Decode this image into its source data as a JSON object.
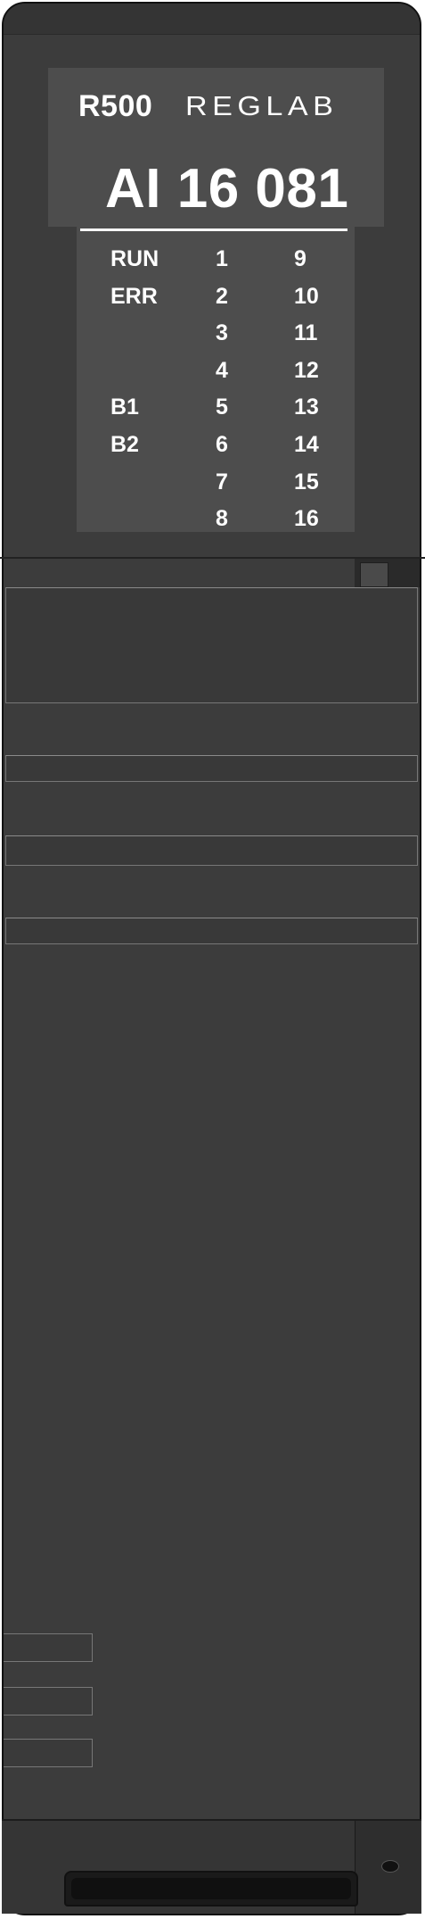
{
  "device": {
    "series": "R500",
    "brand": "REGLAB",
    "model": "AI 16 081"
  },
  "leds": {
    "labels": [
      "RUN",
      "ERR",
      "",
      "",
      "B1",
      "B2",
      "",
      ""
    ],
    "channels_left": [
      "1",
      "2",
      "3",
      "4",
      "5",
      "6",
      "7",
      "8"
    ],
    "channels_right": [
      "9",
      "10",
      "11",
      "12",
      "13",
      "14",
      "15",
      "16"
    ]
  },
  "colors": {
    "housing": "#3c3c3c",
    "panel": "#4d4d4d",
    "text": "#ffffff"
  }
}
